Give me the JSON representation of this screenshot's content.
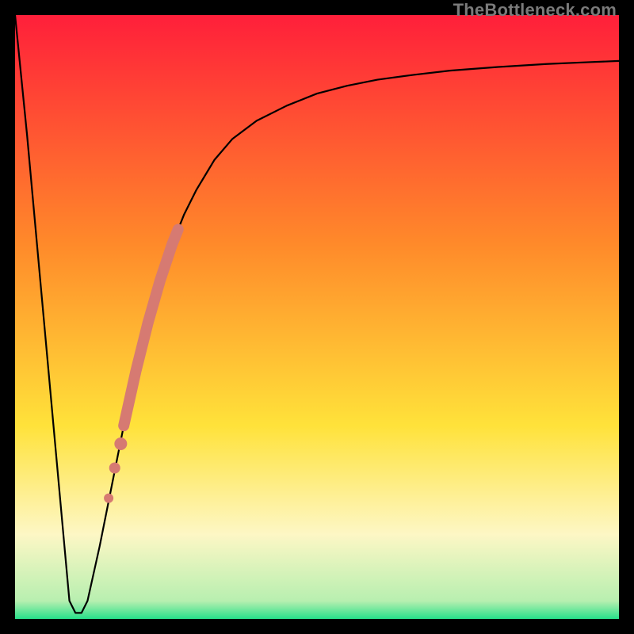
{
  "watermark": "TheBottleneck.com",
  "colors": {
    "gradient_top": "#ff1f3a",
    "gradient_mid1": "#ff8a2a",
    "gradient_mid2": "#ffe23a",
    "gradient_pale_yellow": "#fdf7c5",
    "gradient_bottom": "#27e08a",
    "curve": "#000000",
    "marker": "#d67a72",
    "frame": "#000000"
  },
  "chart_data": {
    "type": "line",
    "title": "",
    "xlabel": "",
    "ylabel": "",
    "xlim": [
      0,
      100
    ],
    "ylim": [
      0,
      100
    ],
    "series": [
      {
        "name": "bottleneck-curve",
        "x": [
          0,
          2,
          4,
          6,
          8,
          9,
          10,
          11,
          12,
          14,
          16,
          18,
          20,
          22,
          24,
          26,
          28,
          30,
          33,
          36,
          40,
          45,
          50,
          55,
          60,
          66,
          72,
          80,
          88,
          95,
          100
        ],
        "y": [
          100,
          80,
          58,
          36,
          14,
          3,
          1,
          1,
          3,
          12,
          22,
          32,
          41,
          49,
          56,
          62,
          67,
          71,
          76,
          79.5,
          82.5,
          85,
          87,
          88.3,
          89.3,
          90.1,
          90.8,
          91.4,
          91.9,
          92.2,
          92.4
        ]
      }
    ],
    "highlight_segment": {
      "name": "highlighted-range",
      "x": [
        15.5,
        16.5,
        17.5,
        18.0,
        20.0,
        22.0,
        24.0,
        26.0,
        27.0
      ],
      "y": [
        20.0,
        25.0,
        29.0,
        32.0,
        41.0,
        49.0,
        56.0,
        62.0,
        64.5
      ]
    },
    "highlight_dots": {
      "name": "highlight-dots",
      "x": [
        15.5,
        16.5,
        17.5
      ],
      "y": [
        20.0,
        25.0,
        29.0
      ]
    }
  }
}
